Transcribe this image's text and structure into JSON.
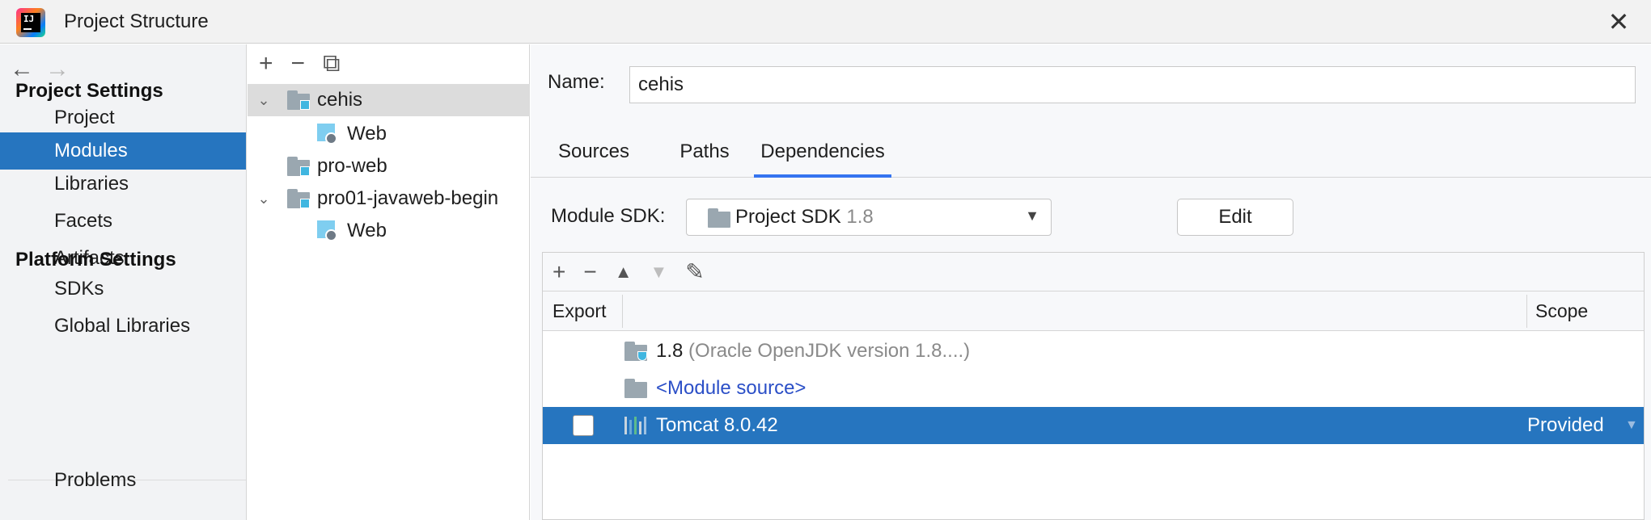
{
  "window": {
    "title": "Project Structure",
    "close_icon": "close-icon"
  },
  "nav": {
    "project_settings_heading": "Project Settings",
    "project_items": [
      "Project",
      "Modules",
      "Libraries",
      "Facets",
      "Artifacts"
    ],
    "platform_settings_heading": "Platform Settings",
    "platform_items": [
      "SDKs",
      "Global Libraries"
    ],
    "problems": "Problems",
    "selected": "Modules"
  },
  "tree": {
    "rows": [
      {
        "label": "cehis",
        "expanded": true,
        "selected": true
      },
      {
        "label": "Web"
      },
      {
        "label": "pro-web"
      },
      {
        "label": "pro01-javaweb-begin",
        "expanded": true
      },
      {
        "label": "Web"
      }
    ]
  },
  "detail": {
    "name_label": "Name:",
    "name_value": "cehis",
    "tabs": [
      "Sources",
      "Paths",
      "Dependencies"
    ],
    "active_tab": "Dependencies",
    "sdk_label": "Module SDK:",
    "sdk_value": "Project SDK",
    "sdk_version": "1.8",
    "edit_label": "Edit",
    "dep_headers": {
      "export": "Export",
      "scope": "Scope"
    },
    "dependencies": [
      {
        "name": "1.8",
        "detail": "(Oracle OpenJDK version 1.8....)"
      },
      {
        "name": "<Module source>"
      },
      {
        "name": "Tomcat 8.0.42",
        "scope": "Provided",
        "exported": false,
        "selected": true
      }
    ]
  },
  "colors": {
    "selection": "#2675bf",
    "accent_tab": "#3574f0",
    "link": "#2b4fc7"
  }
}
